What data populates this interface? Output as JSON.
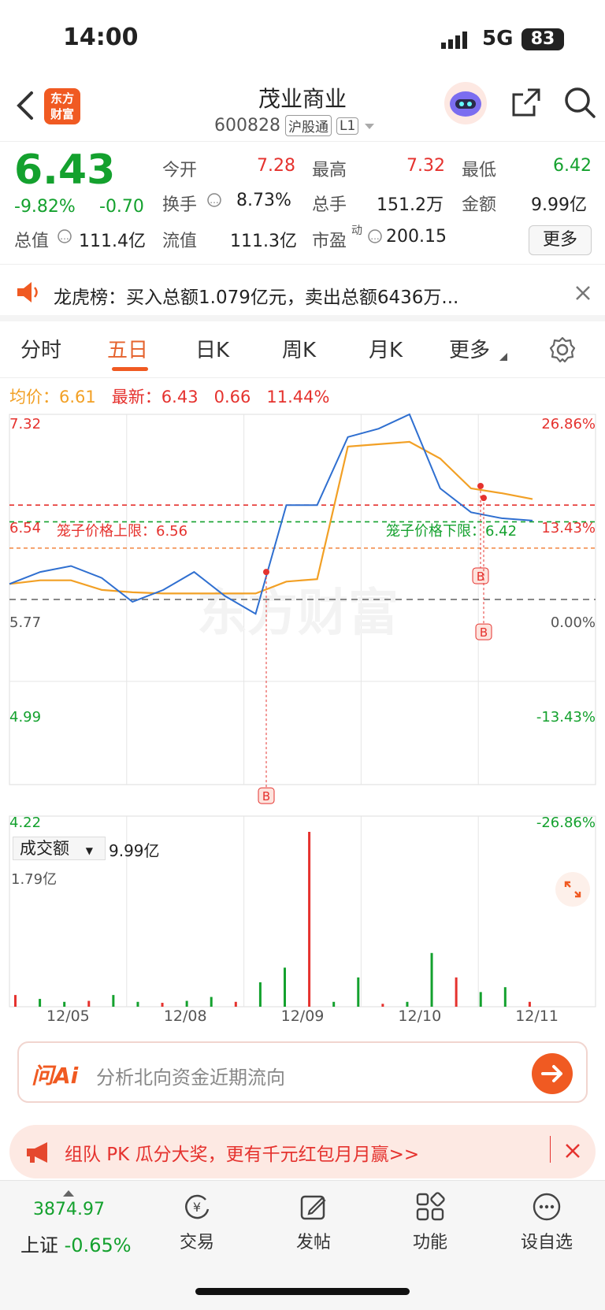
{
  "status_bar": {
    "time": "14:00",
    "network": "5G",
    "battery": "83"
  },
  "header": {
    "logo_text": "东方财富",
    "title": "茂业商业",
    "code": "600828",
    "tag": "沪股通",
    "level": "L1"
  },
  "quote": {
    "price": "6.43",
    "change_pct": "-9.82%",
    "change": "-0.70",
    "open_label": "今开",
    "open": "7.28",
    "high_label": "最高",
    "high": "7.32",
    "low_label": "最低",
    "low": "6.42",
    "turnover_label": "换手",
    "turnover": "8.73%",
    "volume_label": "总手",
    "volume": "151.2万",
    "amount_label": "金额",
    "amount": "9.99亿",
    "mcap_label": "总值",
    "mcap": "111.4亿",
    "float_label": "流值",
    "float": "111.3亿",
    "pe_label": "市盈",
    "pe_sup": "动",
    "pe": "200.15",
    "more": "更多"
  },
  "notice": {
    "text": "龙虎榜：买入总额1.079亿元，卖出总额6436万..."
  },
  "tabs": [
    "分时",
    "五日",
    "日K",
    "周K",
    "月K",
    "更多"
  ],
  "active_tab": "五日",
  "avg_bar": {
    "avg_label": "均价：",
    "avg": "6.61",
    "latest_label": "最新：",
    "latest": "6.43",
    "diff": "0.66",
    "diff_pct": "11.44%"
  },
  "chart": {
    "y_left": [
      "7.32",
      "6.54",
      "5.77",
      "4.99",
      "4.22"
    ],
    "y_right": [
      "26.86%",
      "13.43%",
      "0.00%",
      "-13.43%",
      "-26.86%"
    ],
    "upper_limit_label": "笼子价格上限：6.56",
    "lower_limit_label": "笼子价格下限：6.42",
    "marker": "B",
    "watermark": "东方财富"
  },
  "chart_data": {
    "type": "line",
    "x_labels": [
      "12/05",
      "12/08",
      "12/09",
      "12/10",
      "12/11"
    ],
    "ylim": [
      4.22,
      7.32
    ],
    "base_price": 5.77,
    "reference_lines": {
      "upper_cage": 6.56,
      "lower_cage": 6.42,
      "prev_close_today": 7.13
    },
    "series": [
      {
        "name": "最新",
        "values": [
          5.9,
          6.0,
          6.05,
          5.95,
          5.75,
          5.85,
          6.0,
          5.8,
          5.65,
          6.56,
          6.56,
          7.13,
          7.2,
          7.32,
          6.7,
          6.5,
          6.45,
          6.43
        ]
      },
      {
        "name": "均价",
        "values": [
          5.9,
          5.93,
          5.93,
          5.85,
          5.83,
          5.82,
          5.82,
          5.82,
          5.82,
          5.92,
          5.94,
          7.05,
          7.07,
          7.09,
          6.95,
          6.7,
          6.66,
          6.61
        ]
      }
    ],
    "volume": {
      "label": "成交额",
      "total": "9.99亿",
      "max_label": "1.79亿",
      "bars": [
        0.12,
        0.08,
        0.05,
        0.06,
        0.12,
        0.05,
        0.04,
        0.06,
        0.1,
        0.05,
        0.25,
        0.4,
        1.79,
        0.05,
        0.3,
        0.03,
        0.05,
        0.55,
        0.3,
        0.15,
        0.2,
        0.05
      ]
    }
  },
  "ai": {
    "logo": "问Ai",
    "placeholder": "分析北向资金近期流向"
  },
  "promo": {
    "text": "组队 PK 瓜分大奖，更有千元红包月月赢>>"
  },
  "bottom_nav": {
    "index_value": "3874.97",
    "index_name": "上证",
    "index_change": "-0.65%",
    "items": [
      "交易",
      "发帖",
      "功能",
      "设自选"
    ]
  },
  "colors": {
    "up": "#e5322e",
    "down": "#14a12e",
    "price_line": "#2f6fd0",
    "avg_line": "#f2a025",
    "accent": "#f05a22"
  }
}
